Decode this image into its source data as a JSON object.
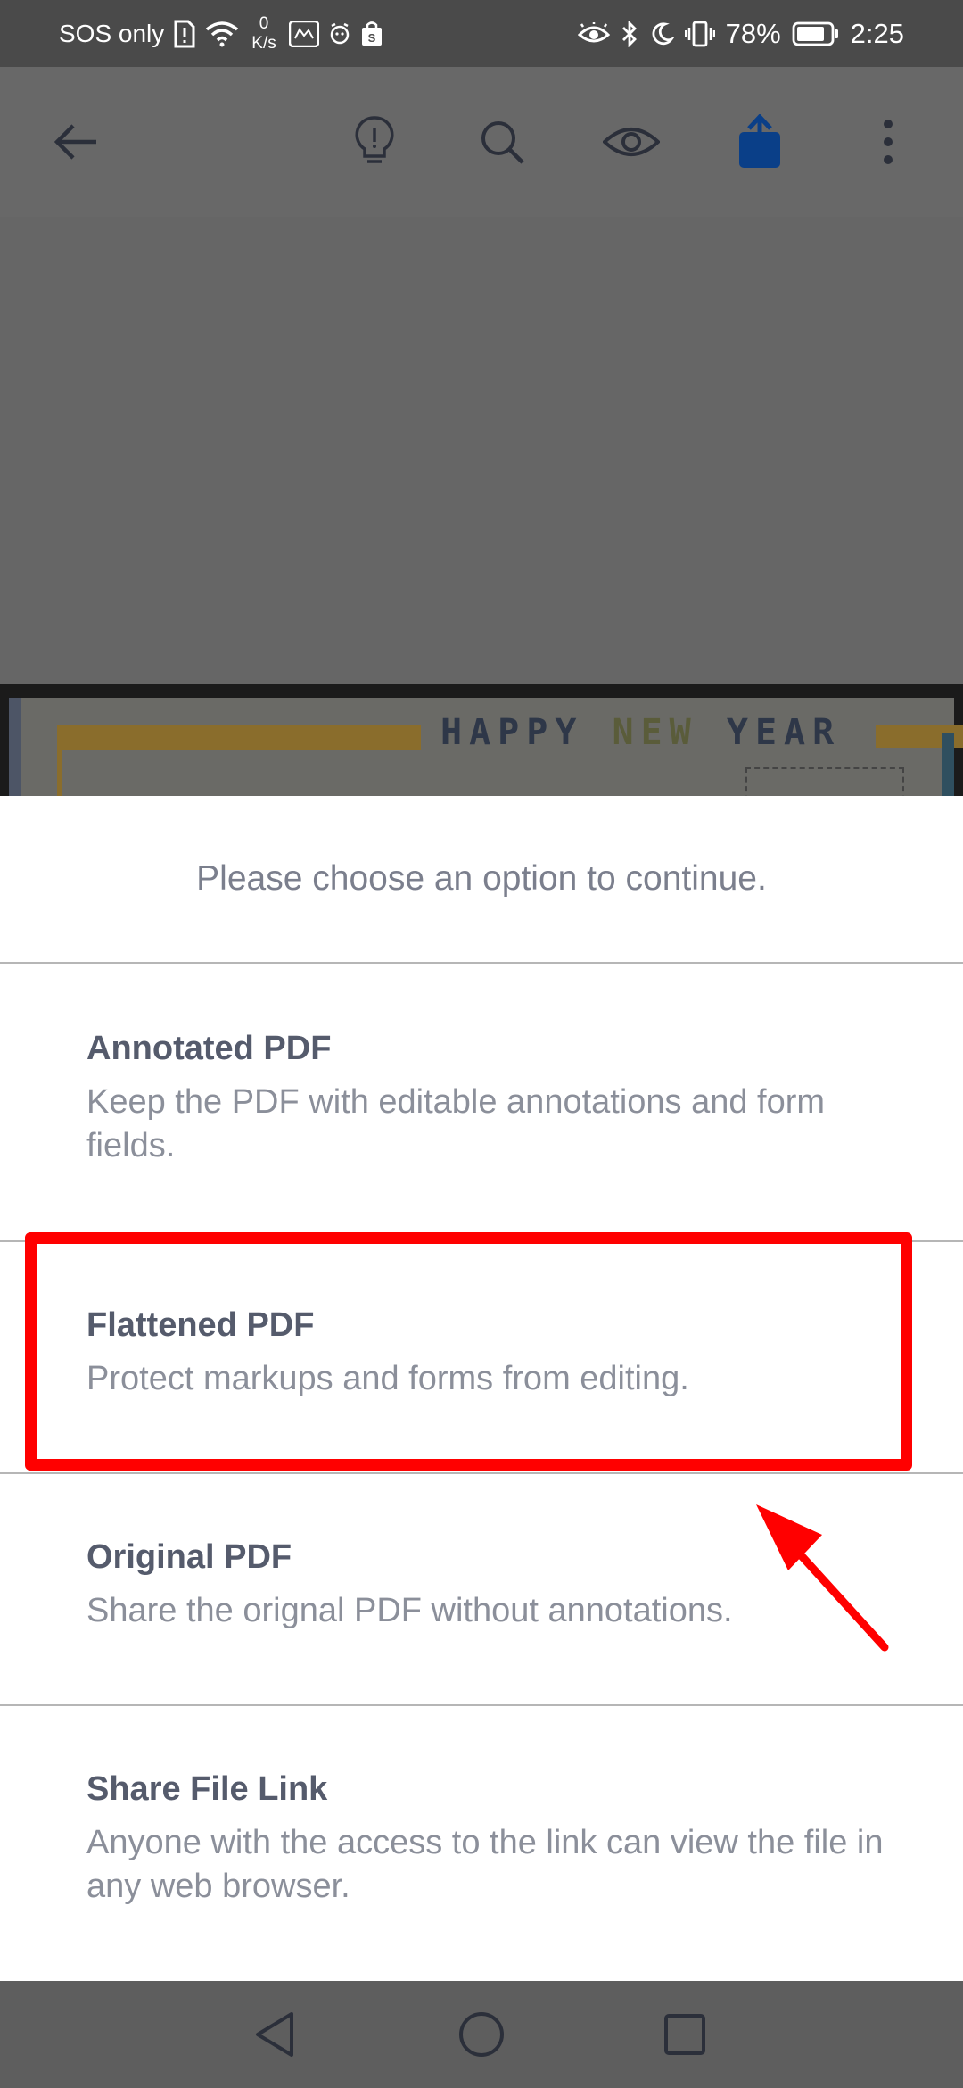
{
  "status_bar": {
    "carrier": "SOS only",
    "net_speed_value": "0",
    "net_speed_unit": "K/s",
    "battery_percent": "78%",
    "time": "2:25"
  },
  "app_bar": {
    "icons": [
      "back-arrow-icon",
      "lightbulb-icon",
      "search-icon",
      "eye-icon",
      "share-icon",
      "more-vert-icon"
    ],
    "accent_color": "#0a5cc4"
  },
  "document": {
    "card_title_a": "HAPPY",
    "card_title_b": "NEW",
    "card_title_c": "YEAR"
  },
  "sheet": {
    "prompt": "Please choose an option to continue.",
    "options": [
      {
        "title": "Annotated PDF",
        "description": "Keep the PDF with editable annotations and form fields."
      },
      {
        "title": "Flattened PDF",
        "description": "Protect markups and forms from editing."
      },
      {
        "title": "Original PDF",
        "description": "Share the orignal PDF without annotations."
      },
      {
        "title": "Share File Link",
        "description": "Anyone with the access to the link can view the file in any web browser."
      }
    ]
  },
  "annotation": {
    "highlight_color": "#ff0000"
  },
  "nav_bar": {
    "icons": [
      "back-triangle-icon",
      "home-circle-icon",
      "recents-square-icon"
    ]
  }
}
